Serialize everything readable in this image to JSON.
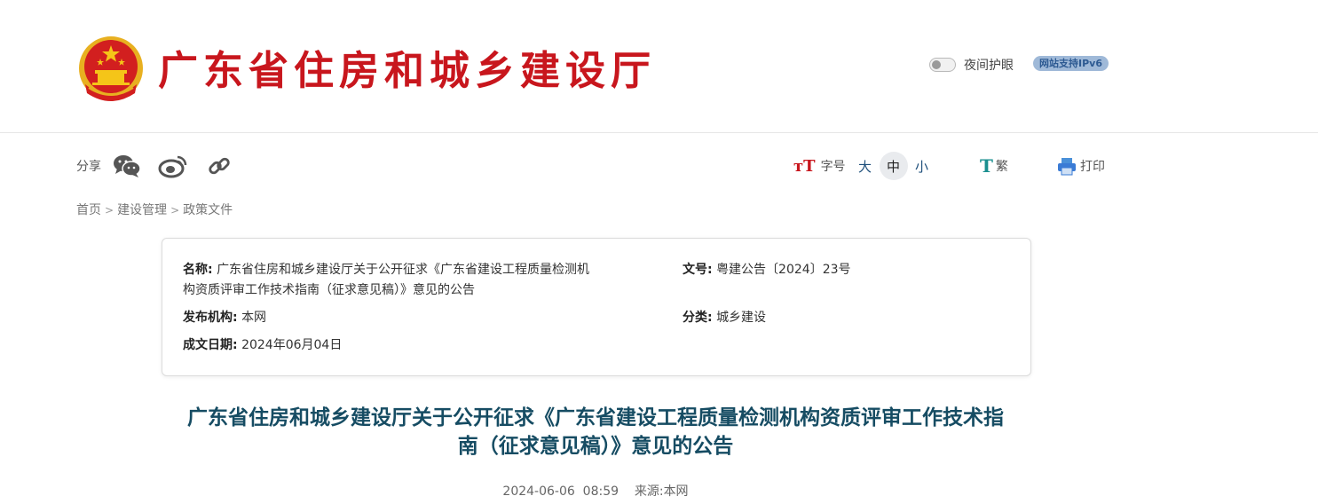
{
  "header": {
    "site_title": "广东省住房和城乡建设厅",
    "night_mode_label": "夜间护眼",
    "ipv6_badge": "网站支持IPv6"
  },
  "share": {
    "label": "分享",
    "icons": [
      "wechat-icon",
      "weibo-icon",
      "link-icon"
    ]
  },
  "tools": {
    "font_size_label": "字号",
    "font_sizes": [
      "大",
      "中",
      "小"
    ],
    "font_size_selected": "中",
    "traditional_label": "繁",
    "print_label": "打印"
  },
  "breadcrumb": [
    "首页",
    "建设管理",
    "政策文件"
  ],
  "info": {
    "name_label": "名称:",
    "name_line1": "广东省住房和城乡建设厅关于公开征求《广东省建设工程质量检测机",
    "name_line2": "构资质评审工作技术指南（征求意见稿）》意见的公告",
    "doc_no_label": "文号:",
    "doc_no": "粤建公告〔2024〕23号",
    "publisher_label": "发布机构:",
    "publisher": "本网",
    "category_label": "分类:",
    "category": "城乡建设",
    "date_label": "成文日期:",
    "date": "2024年06月04日"
  },
  "article": {
    "title_line1": "广东省住房和城乡建设厅关于公开征求《广东省建设工程质量检测机构资质评审工作技术指",
    "title_line2": "南（征求意见稿）》意见的公告",
    "publish_time": "2024-06-06  08:59",
    "source_label": "来源:",
    "source": "本网"
  },
  "colors": {
    "brand_red": "#c8161d",
    "title_teal": "#164c63",
    "link_blue": "#20507c"
  }
}
